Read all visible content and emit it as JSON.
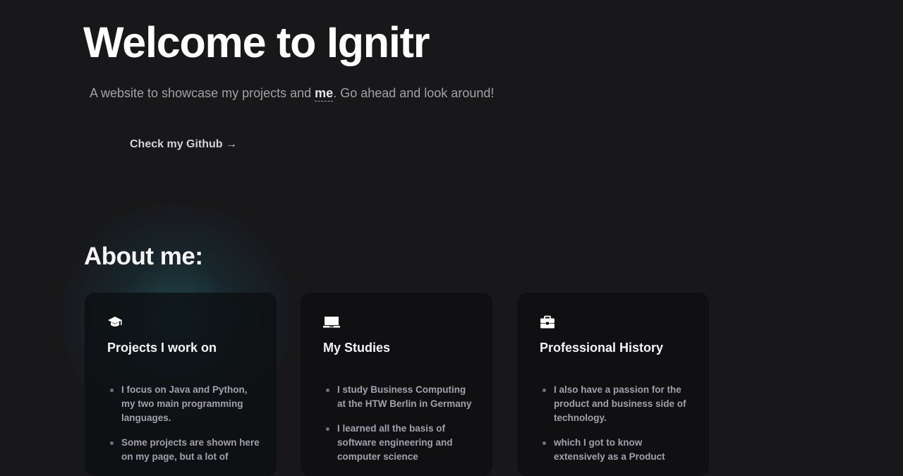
{
  "hero": {
    "title": "Welcome to Ignitr",
    "subtitle_before": "A website to showcase my projects and ",
    "subtitle_me": "me",
    "subtitle_after": ". Go ahead and look around!",
    "github_label": "Check my Github →"
  },
  "about": {
    "title": "About me:",
    "cards": [
      {
        "icon": "graduation-cap-icon",
        "title": "Projects I work on",
        "items": [
          "I focus on Java and Python, my two main programming languages.",
          "Some projects are shown here on my page, but a lot of"
        ]
      },
      {
        "icon": "laptop-icon",
        "title": "My Studies",
        "items": [
          "I study Business Computing at the HTW Berlin in Germany",
          "I learned all the basis of software engineering and computer science"
        ]
      },
      {
        "icon": "briefcase-icon",
        "title": "Professional History",
        "items": [
          "I also have a passion for the product and business side of technology.",
          "which I got to know extensively as a Product"
        ]
      }
    ]
  },
  "colors": {
    "background": "#18181b",
    "card_background": "#101012",
    "glow": "#266e76",
    "muted_text": "#a1a1aa"
  }
}
